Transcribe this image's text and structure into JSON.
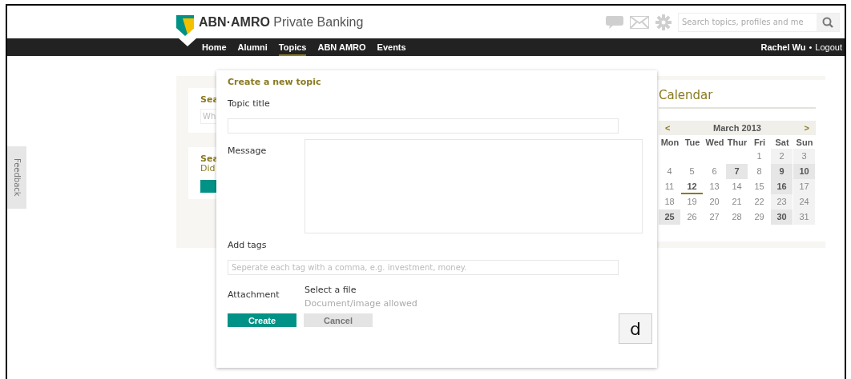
{
  "header": {
    "logo_bold": "ABN·AMRO",
    "logo_rest": "Private Banking",
    "search": {
      "placeholder": "Search topics, profiles and me"
    }
  },
  "nav": {
    "items": [
      {
        "label": "Home",
        "selected": false
      },
      {
        "label": "Alumni",
        "selected": false
      },
      {
        "label": "Topics",
        "selected": true
      },
      {
        "label": "ABN AMRO",
        "selected": false
      },
      {
        "label": "Events",
        "selected": false
      }
    ],
    "user": "Rachel Wu",
    "separator": "•",
    "logout": "Logout"
  },
  "feedback_tab": "Feedback",
  "left_cards": [
    {
      "kind": "search",
      "title": "Sea",
      "placeholder": "Wh"
    },
    {
      "kind": "suggest",
      "title": "Sea",
      "text": "Did"
    }
  ],
  "calendar": {
    "title": "Calendar",
    "prev": "<",
    "month": "March 2013",
    "next": ">",
    "weekdays": [
      "Mon",
      "Tue",
      "Wed",
      "Thur",
      "Fri",
      "Sat",
      "Sun"
    ],
    "weeks": [
      [
        {
          "day": "1",
          "weekend": false,
          "event": false,
          "today": false
        },
        {
          "day": "2",
          "weekend": true,
          "event": false,
          "today": false
        },
        {
          "day": "3",
          "weekend": true,
          "event": false,
          "today": false
        }
      ],
      [
        {
          "day": "4",
          "weekend": false,
          "event": false,
          "today": false
        },
        {
          "day": "5",
          "weekend": false,
          "event": false,
          "today": false
        },
        {
          "day": "6",
          "weekend": false,
          "event": false,
          "today": false
        },
        {
          "day": "7",
          "weekend": false,
          "event": true,
          "today": false
        },
        {
          "day": "8",
          "weekend": false,
          "event": false,
          "today": false
        },
        {
          "day": "9",
          "weekend": true,
          "event": true,
          "today": false
        },
        {
          "day": "10",
          "weekend": true,
          "event": true,
          "today": false
        }
      ],
      [
        {
          "day": "11",
          "weekend": false,
          "event": false,
          "today": false
        },
        {
          "day": "12",
          "weekend": false,
          "event": false,
          "today": true
        },
        {
          "day": "13",
          "weekend": false,
          "event": false,
          "today": false
        },
        {
          "day": "14",
          "weekend": false,
          "event": false,
          "today": false
        },
        {
          "day": "15",
          "weekend": false,
          "event": false,
          "today": false
        },
        {
          "day": "16",
          "weekend": true,
          "event": true,
          "today": false
        },
        {
          "day": "17",
          "weekend": true,
          "event": false,
          "today": false
        }
      ],
      [
        {
          "day": "18",
          "weekend": false,
          "event": false,
          "today": false
        },
        {
          "day": "19",
          "weekend": false,
          "event": false,
          "today": false
        },
        {
          "day": "20",
          "weekend": false,
          "event": false,
          "today": false
        },
        {
          "day": "21",
          "weekend": false,
          "event": false,
          "today": false
        },
        {
          "day": "22",
          "weekend": false,
          "event": false,
          "today": false
        },
        {
          "day": "23",
          "weekend": true,
          "event": false,
          "today": false
        },
        {
          "day": "24",
          "weekend": true,
          "event": false,
          "today": false
        }
      ],
      [
        {
          "day": "25",
          "weekend": false,
          "event": true,
          "today": false
        },
        {
          "day": "26",
          "weekend": false,
          "event": false,
          "today": false
        },
        {
          "day": "27",
          "weekend": false,
          "event": false,
          "today": false
        },
        {
          "day": "28",
          "weekend": false,
          "event": false,
          "today": false
        },
        {
          "day": "29",
          "weekend": false,
          "event": false,
          "today": false
        },
        {
          "day": "30",
          "weekend": true,
          "event": true,
          "today": false
        },
        {
          "day": "31",
          "weekend": true,
          "event": false,
          "today": false
        }
      ]
    ]
  },
  "dialog": {
    "title": "Create a new topic",
    "topic_title_label": "Topic title",
    "message_label": "Message",
    "tags_label": "Add tags",
    "tags_placeholder": "Seperate each tag with a comma, e.g. investment, money.",
    "attachment_label": "Attachment",
    "select_file": "Select a file",
    "attachment_hint": "Document/image allowed",
    "buttons": [
      {
        "label": "Create",
        "kind": "primary"
      },
      {
        "label": "Cancel",
        "kind": "secondary"
      }
    ]
  },
  "key_overlay": "d"
}
